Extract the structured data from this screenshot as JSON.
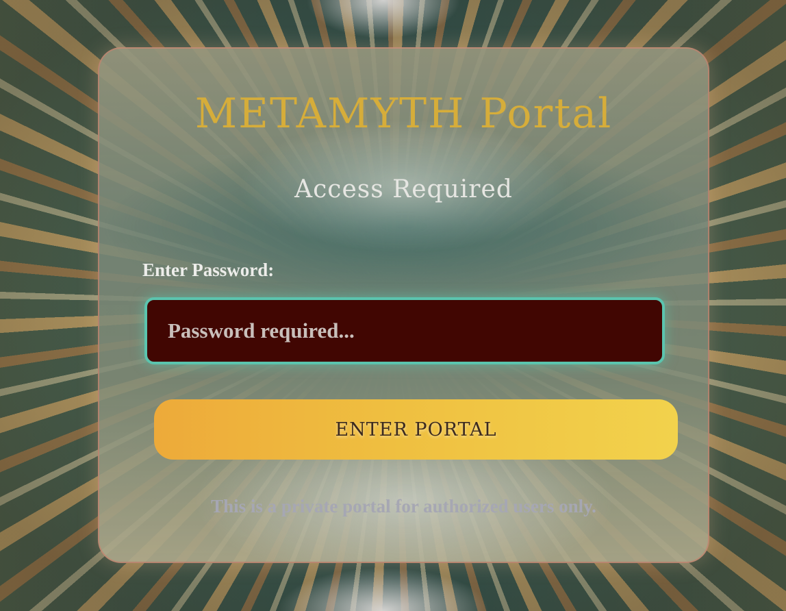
{
  "portal": {
    "title": "METAMYTH Portal",
    "subtitle": "Access Required"
  },
  "login_form": {
    "password_label": "Enter Password:",
    "password_value": "",
    "password_placeholder": "Password required...",
    "submit_label": "ENTER PORTAL"
  },
  "footer": {
    "notice": "This is a private portal for authorized users only."
  },
  "colors": {
    "title": "#d6ad3a",
    "input_background": "#410602",
    "input_border": "#5bc4ae",
    "button_gradient_start": "#edaa3a",
    "button_gradient_end": "#f2d24c",
    "notice_text": "#a6a7b3"
  }
}
